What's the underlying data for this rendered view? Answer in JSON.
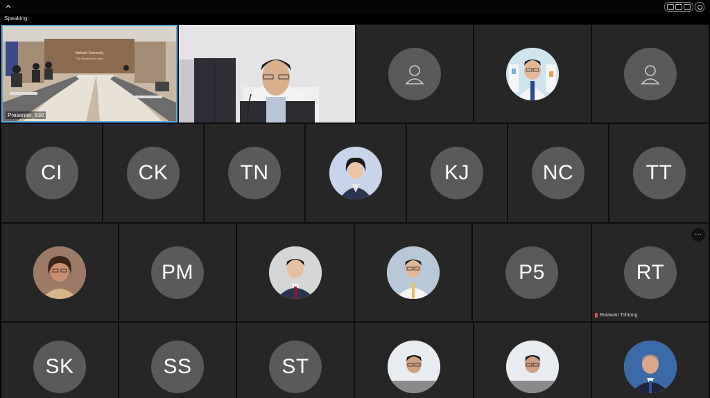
{
  "header": {
    "speaking_label": "Speaking:"
  },
  "videos": {
    "presenter_label": "Presenter_530",
    "banner_line1": "Mahidol University",
    "banner_line2": "The Wisdom of the Land"
  },
  "grid": {
    "row1": [
      {
        "type": "placeholder",
        "icon": "person-placeholder-icon"
      },
      {
        "type": "photo",
        "name": "participant-photo-1"
      },
      {
        "type": "placeholder",
        "icon": "person-placeholder-icon"
      }
    ],
    "row2": [
      "CI",
      "CK",
      "TN",
      "photo",
      "KJ",
      "NC",
      "TT"
    ],
    "row3": [
      "photo",
      "PM",
      "photo",
      "photo",
      "P5",
      "RT"
    ],
    "row4": [
      "SK",
      "SS",
      "ST",
      "photo",
      "photo",
      "photo"
    ]
  },
  "initials": {
    "ci": "CI",
    "ck": "CK",
    "tn": "TN",
    "kj": "KJ",
    "nc": "NC",
    "tt": "TT",
    "pm": "PM",
    "p5": "P5",
    "rt": "RT",
    "sk": "SK",
    "ss": "SS",
    "st": "ST"
  },
  "active_speaker": {
    "name": "Rutawan Tohtong"
  },
  "more_options": {
    "icon": "more-options-icon",
    "glyph": "···"
  }
}
